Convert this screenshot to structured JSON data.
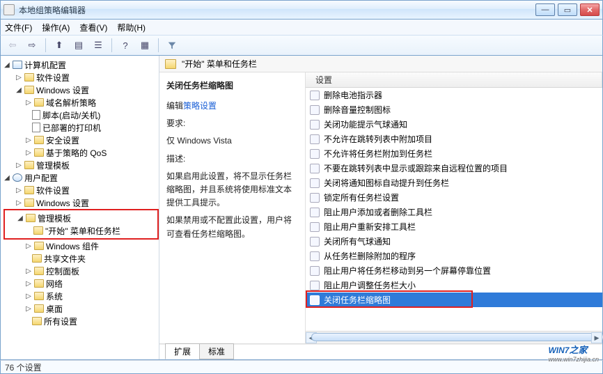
{
  "window": {
    "title": "本地组策略编辑器"
  },
  "menu": {
    "file": "文件(F)",
    "action": "操作(A)",
    "view": "查看(V)",
    "help": "帮助(H)"
  },
  "tree": {
    "root": "计算机配置",
    "computer": {
      "label": "计算机配置",
      "software": "软件设置",
      "windows": "Windows 设置",
      "dns": "域名解析策略",
      "scripts": "脚本(启动/关机)",
      "printers": "已部署的打印机",
      "security": "安全设置",
      "qos": "基于策略的 QoS",
      "admintpl": "管理模板"
    },
    "user": {
      "label": "用户配置",
      "software": "软件设置",
      "windows": "Windows 设置",
      "admintpl": "管理模板",
      "startmenu": "\"开始\" 菜单和任务栏",
      "components": "Windows 组件",
      "shared": "共享文件夹",
      "cpl": "控制面板",
      "network": "网络",
      "system": "系统",
      "desktop": "桌面",
      "allsettings": "所有设置"
    }
  },
  "rightpane": {
    "header": "\"开始\" 菜单和任务栏",
    "desc": {
      "title": "关闭任务栏缩略图",
      "edit_prefix": "编辑",
      "edit_link": "策略设置",
      "req_label": "要求:",
      "req": "仅 Windows Vista",
      "desc_label": "描述:",
      "p1": "如果启用此设置，将不显示任务栏缩略图，并且系统将使用标准文本提供工具提示。",
      "p2": "如果禁用或不配置此设置，用户将可查看任务栏缩略图。"
    },
    "list": {
      "header": "设置",
      "items": [
        "删除电池指示器",
        "删除音量控制图标",
        "关闭功能提示气球通知",
        "不允许在跳转列表中附加项目",
        "不允许将任务栏附加到任务栏",
        "不要在跳转列表中显示或跟踪来自远程位置的项目",
        "关闭将通知图标自动提升到任务栏",
        "锁定所有任务栏设置",
        "阻止用户添加或者删除工具栏",
        "阻止用户重新安排工具栏",
        "关闭所有气球通知",
        "从任务栏删除附加的程序",
        "阻止用户将任务栏移动到另一个屏幕停靠位置",
        "阻止用户调整任务栏大小",
        "关闭任务栏缩略图"
      ],
      "selected_index": 14
    },
    "tabs": {
      "extended": "扩展",
      "standard": "标准"
    }
  },
  "status": "76 个设置",
  "watermark": {
    "logo": "WIN7",
    "suffix": "之家",
    "url": "www.win7zhijia.cn"
  }
}
